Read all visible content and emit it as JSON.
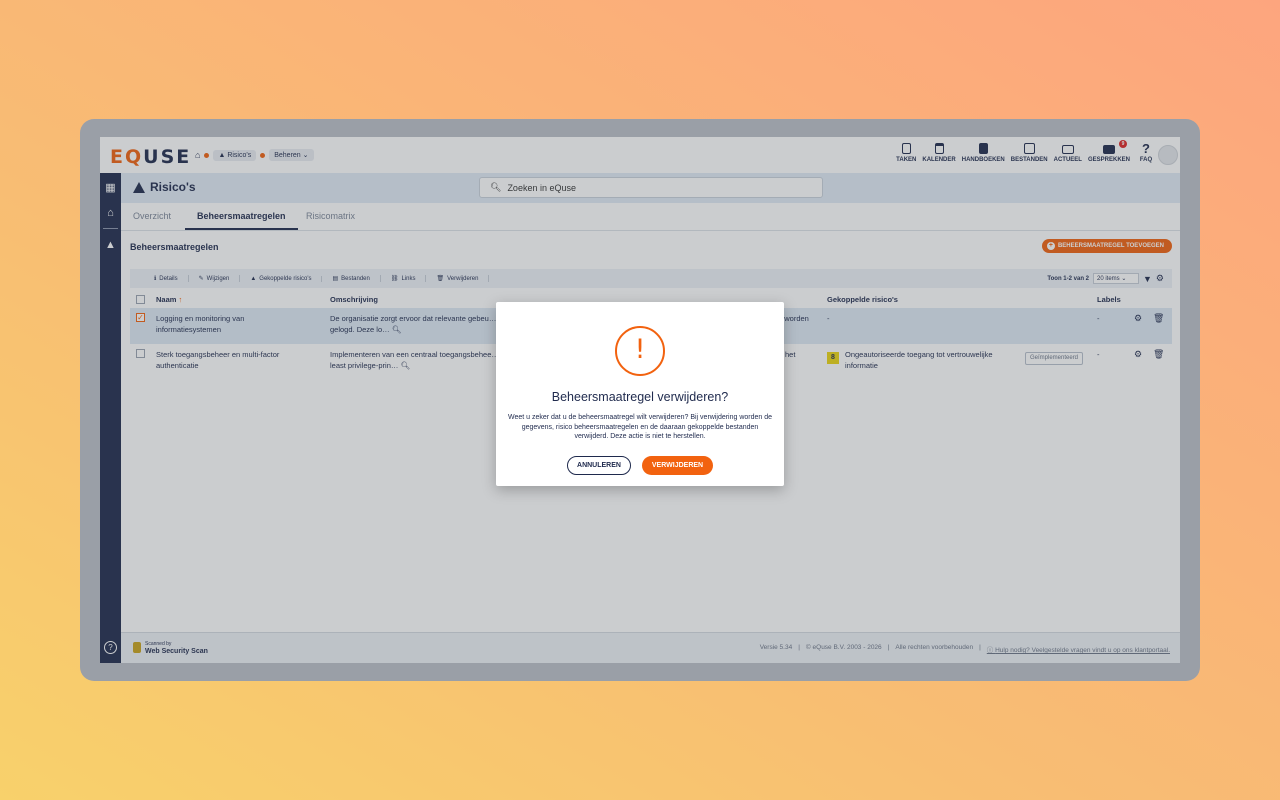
{
  "app": {
    "logo_prefix": "E",
    "logo_q": "Q",
    "logo_suffix": "USE"
  },
  "breadcrumb": {
    "item1": "Risico's",
    "item2": "Beheren ⌄"
  },
  "top_nav": [
    {
      "label": "TAKEN",
      "icon": "clipboard-icon"
    },
    {
      "label": "KALENDER",
      "icon": "calendar-icon"
    },
    {
      "label": "HANDBOEKEN",
      "icon": "book-icon"
    },
    {
      "label": "BESTANDEN",
      "icon": "archive-icon"
    },
    {
      "label": "ACTUEEL",
      "icon": "news-icon"
    },
    {
      "label": "GESPREKKEN",
      "icon": "chat-icon",
      "badge": "9"
    },
    {
      "label": "FAQ",
      "icon": "question-icon"
    }
  ],
  "header": {
    "title": "Risico's",
    "search_placeholder": "Zoeken in eQuse"
  },
  "tabs": [
    "Overzicht",
    "Beheersmaatregelen",
    "Risicomatrix"
  ],
  "active_tab": "Beheersmaatregelen",
  "section": {
    "title": "Beheersmaatregelen",
    "add_button": "BEHEERSMAATREGEL TOEVOEGEN"
  },
  "toolbar": {
    "details": "Details",
    "edit": "Wijzigen",
    "linked_risks": "Gekoppelde risico's",
    "files": "Bestanden",
    "links": "Links",
    "delete": "Verwijderen",
    "paging": "Toon 1-2 van 2",
    "page_size": "20 items"
  },
  "table": {
    "headers": {
      "name": "Naam",
      "description": "Omschrijving",
      "linked": "Gekoppelde risico's",
      "labels": "Labels"
    },
    "rows": [
      {
        "name": "Logging en monitoring van informatiesystemen",
        "description": "De organisatie zorgt ervoor dat relevante gebeu… gelogd. Deze lo…",
        "desc_tail": "n worden",
        "linked": "-",
        "labels": "-",
        "checked": true
      },
      {
        "name": "Sterk toegangsbeheer en multi-factor authenticatie",
        "description": "Implementeren van een centraal toegangsbehee… least privilege-prin…",
        "desc_tail": "het",
        "linked_level": "8",
        "linked": "Ongeautoriseerde toegang tot vertrouwelijke informatie",
        "status": "Geïmplementeerd",
        "labels": "-",
        "checked": false
      }
    ]
  },
  "footer": {
    "scan_small": "Scanned by",
    "scan_name": "Web Security Scan",
    "version": "Versie 5.34",
    "copyright": "© eQuse B.V. 2003 - 2026",
    "rights": "Alle rechten voorbehouden",
    "help": "Hulp nodig? Veelgestelde vragen vindt u op ons klantportaal."
  },
  "modal": {
    "title": "Beheersmaatregel verwijderen?",
    "text": "Weet u zeker dat u de beheersmaatregel wilt verwijderen? Bij verwijdering worden de gegevens, risico beheersmaatregelen en de daaraan gekoppelde bestanden verwijderd. Deze actie is niet te herstellen.",
    "cancel": "ANNULEREN",
    "confirm": "VERWIJDEREN"
  },
  "colors": {
    "brand_navy": "#1f2a4d",
    "accent_orange": "#f2620f",
    "risk_yellow": "#ecd611"
  }
}
